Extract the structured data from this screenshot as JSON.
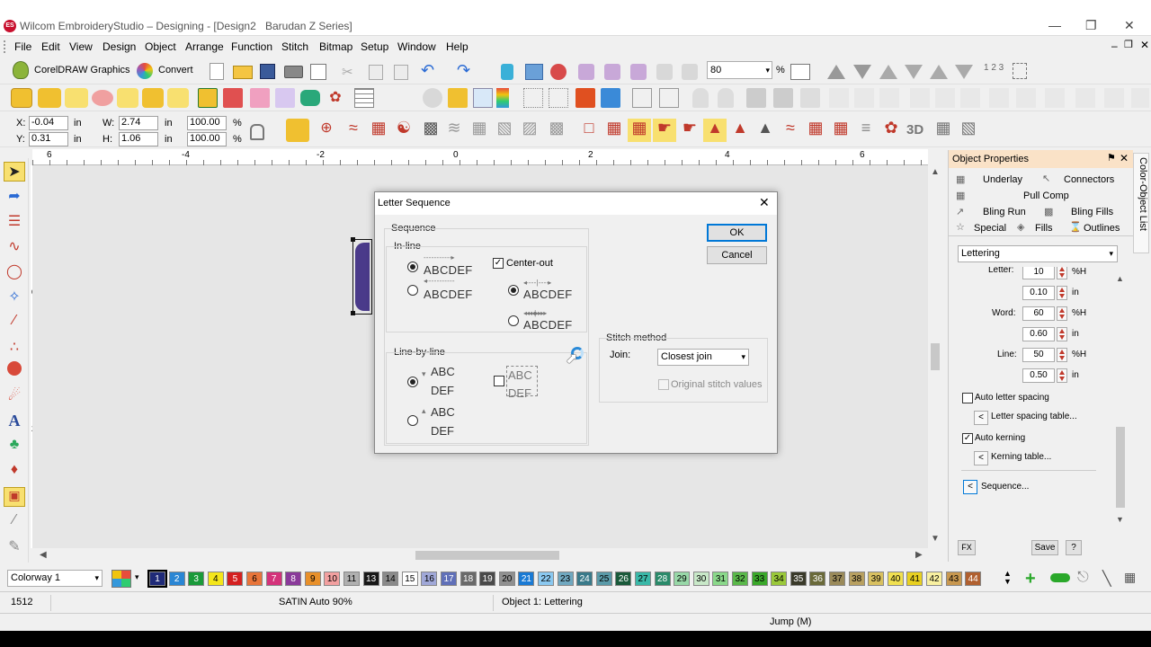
{
  "window": {
    "title": "Wilcom EmbroideryStudio – Designing - [Design2",
    "machine": "Barudan Z Series]",
    "app_icon": "ES"
  },
  "menu": [
    "File",
    "Edit",
    "View",
    "Design",
    "Object",
    "Arrange",
    "Function",
    "Stitch",
    "Bitmap",
    "Setup",
    "Window",
    "Help"
  ],
  "toolbar": {
    "coreldraw_label": "CorelDRAW Graphics",
    "convert_label": "Convert",
    "zoom_value": "80",
    "zoom_unit": "%",
    "threed_label": "3D",
    "numbers_label": "1 2 3"
  },
  "props": {
    "x_label": "X:",
    "x_value": "-0.04",
    "x_unit": "in",
    "y_label": "Y:",
    "y_value": "0.31",
    "y_unit": "in",
    "w_label": "W:",
    "w_value": "2.74",
    "w_unit": "in",
    "h_label": "H:",
    "h_value": "1.06",
    "h_unit": "in",
    "sx_value": "100.00",
    "sy_value": "100.00",
    "pct": "%"
  },
  "ruler": {
    "h_ticks": [
      "6",
      "-4",
      "-2",
      "0",
      "2",
      "4",
      "6"
    ],
    "v_ticks": [
      "0",
      "2"
    ]
  },
  "dialog": {
    "title": "Letter Sequence",
    "sequence_label": "Sequence",
    "inline_label": "In-line",
    "sample_abcdef": "ABCDEF",
    "center_out_label": "Center-out",
    "line_by_line_label": "Line-by-line",
    "sample_abc": "ABC",
    "sample_def": "DEF",
    "stitch_method_label": "Stitch method",
    "join_label": "Join:",
    "join_value": "Closest join",
    "original_stitch_label": "Original stitch values",
    "ok_label": "OK",
    "cancel_label": "Cancel"
  },
  "panel": {
    "title": "Object Properties",
    "side_tab": "Color-Object List",
    "tabs": {
      "underlay": "Underlay",
      "connectors": "Connectors",
      "pull_comp": "Pull Comp",
      "bling_run": "Bling Run",
      "bling_fills": "Bling Fills",
      "special": "Special",
      "fills": "Fills",
      "outlines": "Outlines"
    },
    "type_value": "Lettering",
    "letter_label": "Letter:",
    "letter_pct": "10",
    "letter_in": "0.10",
    "word_label": "Word:",
    "word_pct": "60",
    "word_in": "0.60",
    "line_label": "Line:",
    "line_pct": "50",
    "line_in": "0.50",
    "unit_pct_h": "%H",
    "unit_in": "in",
    "auto_letter_spacing": "Auto letter spacing",
    "letter_spacing_table": "Letter spacing table...",
    "auto_kerning": "Auto kerning",
    "kerning_table": "Kerning table...",
    "sequence": "Sequence...",
    "arrow_btn": "<",
    "fx_label": "FX",
    "save_label": "Save",
    "help_label": "?"
  },
  "colorway": {
    "label": "Colorway 1",
    "swatches": [
      {
        "n": "1",
        "c": "#1f2a78"
      },
      {
        "n": "2",
        "c": "#2a86d4"
      },
      {
        "n": "3",
        "c": "#1a9a3a"
      },
      {
        "n": "4",
        "c": "#f4e61a"
      },
      {
        "n": "5",
        "c": "#d42020"
      },
      {
        "n": "6",
        "c": "#e8753a"
      },
      {
        "n": "7",
        "c": "#d4327a"
      },
      {
        "n": "8",
        "c": "#8a3a9a"
      },
      {
        "n": "9",
        "c": "#e8902a"
      },
      {
        "n": "10",
        "c": "#f2a0a0"
      },
      {
        "n": "11",
        "c": "#b0b0b0"
      },
      {
        "n": "13",
        "c": "#181818"
      },
      {
        "n": "14",
        "c": "#8a8a8a"
      },
      {
        "n": "15",
        "c": "#ffffff"
      },
      {
        "n": "16",
        "c": "#a0a8d8"
      },
      {
        "n": "17",
        "c": "#6070b8"
      },
      {
        "n": "18",
        "c": "#6a6a6a"
      },
      {
        "n": "19",
        "c": "#4a4a4a"
      },
      {
        "n": "20",
        "c": "#909090"
      },
      {
        "n": "21",
        "c": "#1a7ad4"
      },
      {
        "n": "22",
        "c": "#8ac8f0"
      },
      {
        "n": "23",
        "c": "#70a8c0"
      },
      {
        "n": "24",
        "c": "#3a7a8a"
      },
      {
        "n": "25",
        "c": "#5a9aa8"
      },
      {
        "n": "26",
        "c": "#1a5a3a"
      },
      {
        "n": "27",
        "c": "#3ab8a8"
      },
      {
        "n": "28",
        "c": "#2a8a6a"
      },
      {
        "n": "29",
        "c": "#98d8a8"
      },
      {
        "n": "30",
        "c": "#c8e8c8"
      },
      {
        "n": "31",
        "c": "#8ad88a"
      },
      {
        "n": "32",
        "c": "#5ab84a"
      },
      {
        "n": "33",
        "c": "#3aa82a"
      },
      {
        "n": "34",
        "c": "#9ac83a"
      },
      {
        "n": "35",
        "c": "#3a3a2a"
      },
      {
        "n": "36",
        "c": "#6a6a3a"
      },
      {
        "n": "37",
        "c": "#9a8a5a"
      },
      {
        "n": "38",
        "c": "#b8a060"
      },
      {
        "n": "39",
        "c": "#d8c060"
      },
      {
        "n": "40",
        "c": "#f0e050"
      },
      {
        "n": "41",
        "c": "#e8d020"
      },
      {
        "n": "42",
        "c": "#f8f0a0"
      },
      {
        "n": "43",
        "c": "#c89850"
      },
      {
        "n": "44",
        "c": "#b06030"
      }
    ]
  },
  "status": {
    "stitch_count": "1512",
    "stitch_type": "SATIN Auto 90%",
    "object_info": "Object 1: Lettering",
    "function": "Jump (M)"
  },
  "colors": {
    "accent": "#0078d7",
    "panel_title_bg": "#fae2c7",
    "lettering_purple": "#4a3a8a"
  }
}
